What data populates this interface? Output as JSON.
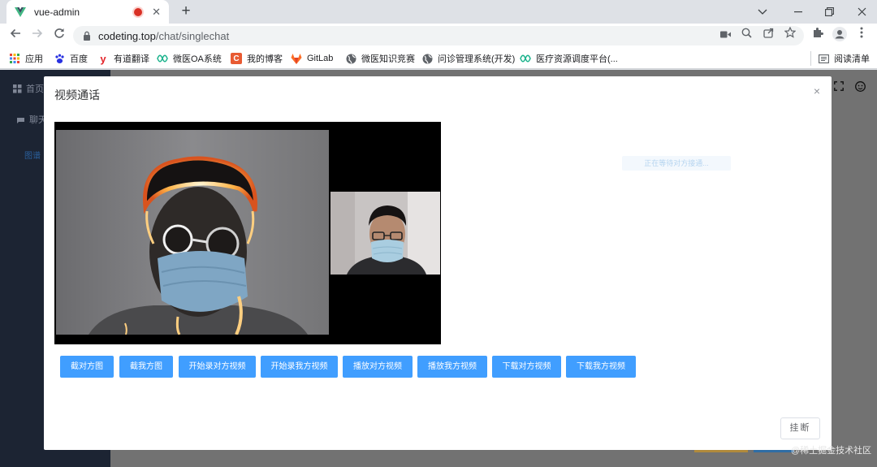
{
  "browser": {
    "tab": {
      "title": "vue-admin",
      "close_symbol": "✕"
    },
    "new_tab_symbol": "+",
    "url": {
      "host": "codeting.top",
      "path": "/chat/singlechat"
    },
    "bookmarks": [
      {
        "label": "应用",
        "icon": "apps-grid-icon"
      },
      {
        "label": "百度",
        "icon": "baidu-paw-icon"
      },
      {
        "label": "有道翻译",
        "icon": "youdao-icon"
      },
      {
        "label": "微医OA系统",
        "icon": "weiyi-icon"
      },
      {
        "label": "我的博客",
        "icon": "blog-c-icon"
      },
      {
        "label": "GitLab",
        "icon": "gitlab-icon"
      },
      {
        "label": "微医知识竞赛",
        "icon": "globe-icon"
      },
      {
        "label": "问诊管理系统(开发)",
        "icon": "globe-icon"
      },
      {
        "label": "医疗资源调度平台(...",
        "icon": "weiyi-icon"
      }
    ],
    "reading_list": "阅读清单"
  },
  "page": {
    "sidebar": [
      {
        "label": "首页"
      },
      {
        "label": "聊天"
      },
      {
        "label": "图谱"
      }
    ]
  },
  "modal": {
    "title": "视频通话",
    "close_symbol": "×",
    "faint_message": "正在等待对方接通...",
    "buttons": [
      {
        "label": "截对方图"
      },
      {
        "label": "截我方图"
      },
      {
        "label": "开始录对方视频"
      },
      {
        "label": "开始录我方视频"
      },
      {
        "label": "播放对方视频"
      },
      {
        "label": "播放我方视频"
      },
      {
        "label": "下载对方视频"
      },
      {
        "label": "下载我方视频"
      }
    ],
    "hangup_label": "挂断"
  },
  "watermark": "@稀土掘金技术社区",
  "colors": {
    "primary_button": "#409eff",
    "sidebar": "#1c2433",
    "overlay": "#727272"
  }
}
